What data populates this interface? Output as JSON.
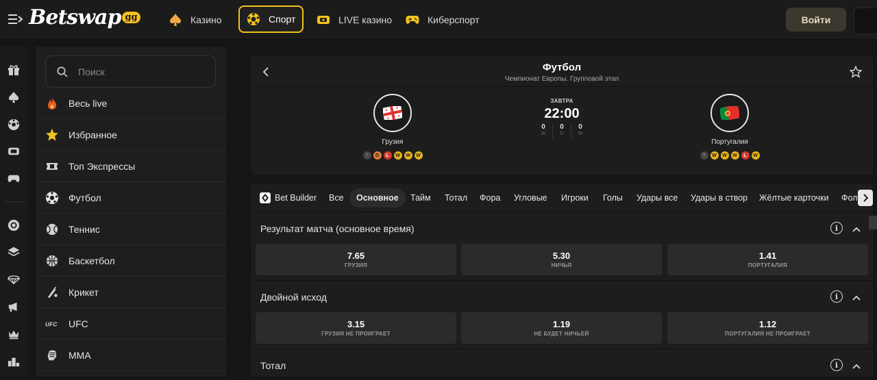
{
  "header": {
    "logo_text": "Betswap",
    "logo_suffix": "gg",
    "nav": [
      {
        "label": "Казино",
        "icon": "spade-icon"
      },
      {
        "label": "Спорт",
        "icon": "soccer-ball-icon",
        "active": true
      },
      {
        "label": "LIVE казино",
        "icon": "live-casino-icon"
      },
      {
        "label": "Киберспорт",
        "icon": "gamepad-icon"
      }
    ],
    "login_label": "Войти"
  },
  "rail_icons": [
    "gift-icon",
    "spade-icon",
    "soccer-ball-icon",
    "live-casino-icon",
    "gamepad-icon",
    "poker-chip-icon",
    "layers-icon",
    "parachute-icon",
    "megaphone-icon",
    "crown-icon",
    "leaderboard-icon"
  ],
  "sidebar": {
    "search_placeholder": "Поиск",
    "items": [
      {
        "label": "Весь live",
        "icon": "fire-icon"
      },
      {
        "label": "Избранное",
        "icon": "star-icon"
      },
      {
        "label": "Топ Экспрессы",
        "icon": "ticket-icon"
      },
      {
        "label": "Футбол",
        "icon": "soccer-ball-icon"
      },
      {
        "label": "Теннис",
        "icon": "tennis-ball-icon"
      },
      {
        "label": "Баскетбол",
        "icon": "basketball-icon"
      },
      {
        "label": "Крикет",
        "icon": "cricket-icon"
      },
      {
        "label": "UFC",
        "icon": "ufc-icon"
      },
      {
        "label": "MMA",
        "icon": "mma-glove-icon"
      }
    ]
  },
  "match": {
    "sport": "Футбол",
    "tournament": "Чемпионат Европы. Групповой этап",
    "day": "ЗАВТРА",
    "time": "22:00",
    "score": [
      {
        "value": "0",
        "label": "W"
      },
      {
        "value": "0",
        "label": "D"
      },
      {
        "value": "0",
        "label": "W"
      }
    ],
    "home": {
      "name": "Грузия",
      "form": [
        "?",
        "D",
        "L",
        "W",
        "W",
        "W"
      ]
    },
    "away": {
      "name": "Португалия",
      "form": [
        "?",
        "W",
        "W",
        "W",
        "L",
        "W"
      ]
    }
  },
  "tabs": [
    "Bet Builder",
    "Все",
    "Основное",
    "Тайм",
    "Тотал",
    "Фора",
    "Угловые",
    "Игроки",
    "Голы",
    "Удары все",
    "Удары в створ",
    "Жёлтые карточки",
    "Фол"
  ],
  "active_tab": "Основное",
  "markets": [
    {
      "title": "Результат матча (основное время)",
      "odds": [
        {
          "value": "7.65",
          "label": "ГРУЗИЯ"
        },
        {
          "value": "5.30",
          "label": "НИЧЬЯ"
        },
        {
          "value": "1.41",
          "label": "ПОРТУГАЛИЯ"
        }
      ]
    },
    {
      "title": "Двойной исход",
      "odds": [
        {
          "value": "3.15",
          "label": "ГРУЗИЯ НЕ ПРОИГРАЕТ"
        },
        {
          "value": "1.19",
          "label": "НЕ БУДЕТ НИЧЬЕЙ"
        },
        {
          "value": "1.12",
          "label": "ПОРТУГАЛИЯ НЕ ПРОИГРАЕТ"
        }
      ]
    },
    {
      "title": "Тотал",
      "odds": []
    }
  ],
  "colors": {
    "accent": "#f2c41b",
    "background": "#151515",
    "panel": "#1d1d1e",
    "odd_button": "#2b2b2c"
  }
}
